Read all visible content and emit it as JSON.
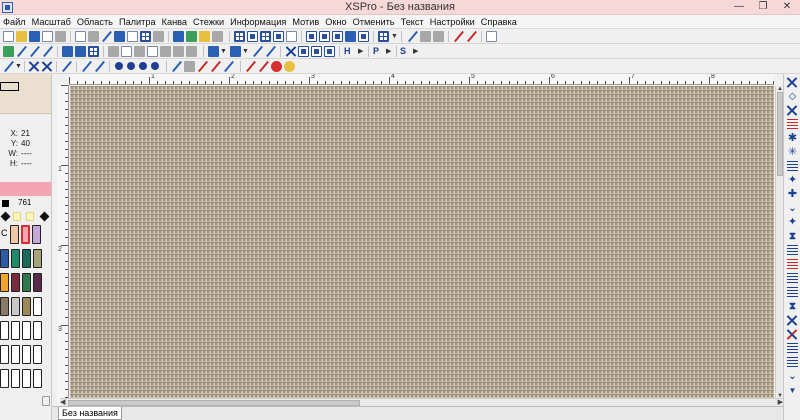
{
  "window": {
    "title": "XSPro - Без названия",
    "minimize": "—",
    "restore": "❐",
    "close": "✕"
  },
  "menu": [
    "Файл",
    "Масштаб",
    "Область",
    "Палитра",
    "Канва",
    "Стежки",
    "Информация",
    "Мотив",
    "Окно",
    "Отменить",
    "Текст",
    "Настройки",
    "Справка"
  ],
  "toolbar3": {
    "letter_h": "H",
    "letter_p": "P",
    "letter_s": "S"
  },
  "status": {
    "x_label": "X:",
    "x_value": "21",
    "y_label": "Y:",
    "y_value": "40",
    "w_label": "W:",
    "w_value": "----",
    "h_label": "H:",
    "h_value": "----"
  },
  "color_panel": {
    "selected_number": "761",
    "selected_color": "#f4a4b2",
    "palette_label": "C",
    "swatches": [
      "#f1c7a6",
      "#f4a4b2",
      "#c6a5d9",
      "#2f5ba6",
      "#1f8a6e",
      "#1a6b5a",
      "#a8a47a",
      "#f2a32e",
      "#7a2b3f",
      "#2e7a4a",
      "#5a2a4a",
      "#c8c8c8",
      "#8a7a6a",
      "#9a8a5a"
    ]
  },
  "ruler": {
    "h_numbers": [
      "1",
      "2",
      "3",
      "4",
      "5",
      "6",
      "7",
      "8",
      "9"
    ],
    "v_numbers": [
      "1",
      "2",
      "3",
      "4",
      "5"
    ]
  },
  "canvas": {
    "fabric_color": "#c8bba6"
  },
  "tabs": {
    "active": "Без названия"
  }
}
